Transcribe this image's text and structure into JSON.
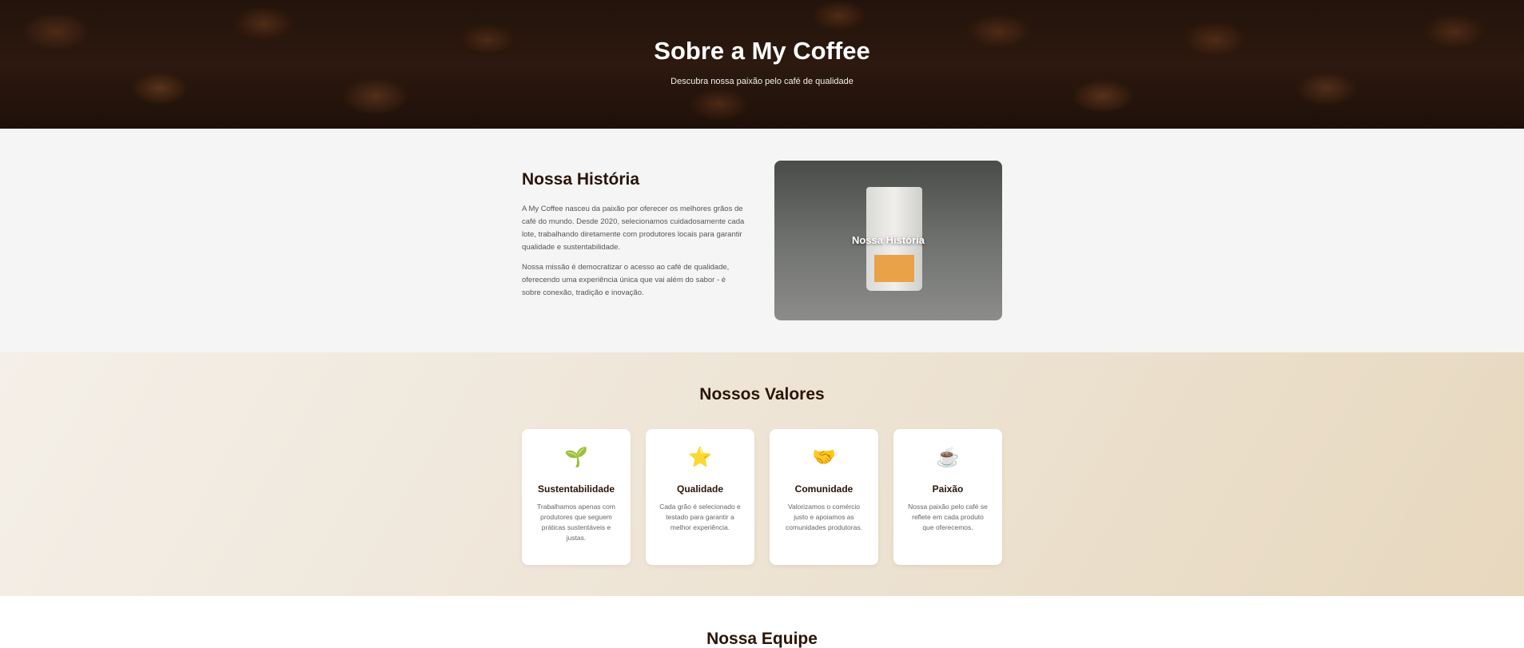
{
  "hero": {
    "title": "Sobre a My Coffee",
    "subtitle": "Descubra nossa paixão pelo café de qualidade"
  },
  "history": {
    "title": "Nossa História",
    "paragraphs": [
      "A My Coffee nasceu da paixão por oferecer os melhores grãos de café do mundo. Desde 2020, selecionamos cuidadosamente cada lote, trabalhando diretamente com produtores locais para garantir qualidade e sustentabilidade.",
      "Nossa missão é democratizar o acesso ao café de qualidade, oferecendo uma experiência única que vai além do sabor - é sobre conexão, tradição e inovação."
    ],
    "image_caption": "Nossa História"
  },
  "values": {
    "title": "Nossos Valores",
    "cards": [
      {
        "icon": "🌱",
        "icon_name": "seedling-icon",
        "title": "Sustentabilidade",
        "text": "Trabalhamos apenas com produtores que seguem práticas sustentáveis e justas."
      },
      {
        "icon": "⭐",
        "icon_name": "star-icon",
        "title": "Qualidade",
        "text": "Cada grão é selecionado e testado para garantir a melhor experiência."
      },
      {
        "icon": "🤝",
        "icon_name": "handshake-icon",
        "title": "Comunidade",
        "text": "Valorizamos o comércio justo e apoiamos as comunidades produtoras."
      },
      {
        "icon": "☕",
        "icon_name": "coffee-cup-icon",
        "title": "Paixão",
        "text": "Nossa paixão pelo café se reflete em cada produto que oferecemos."
      }
    ]
  },
  "team": {
    "title": "Nossa Equipe"
  },
  "colors": {
    "heading": "#2a1508",
    "body_text": "#555555",
    "values_bg": "#ede3d3"
  }
}
